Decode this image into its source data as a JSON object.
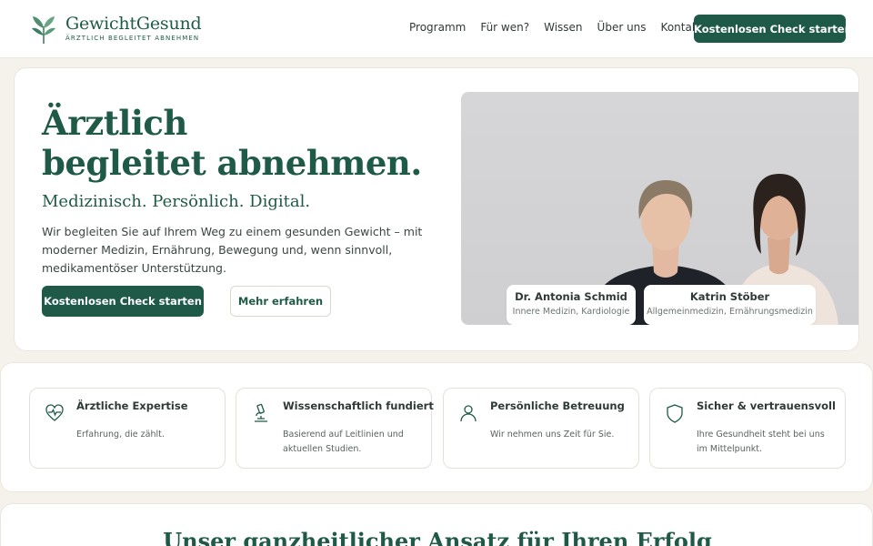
{
  "brand": {
    "name": "GewichtGesund",
    "tagline": "ÄRZTLICH BEGLEITET ABNEHMEN",
    "logo_icon": "leaf-sprout-icon"
  },
  "nav": {
    "items": [
      "Programm",
      "Für wen?",
      "Wissen",
      "Über uns",
      "Kontakt"
    ],
    "cta_label": "Kostenlosen Check starten"
  },
  "hero": {
    "title_line1": "Ärztlich",
    "title_line2": "begleitet abnehmen.",
    "subtitle": "Medizinisch. Persönlich. Digital.",
    "text": "Wir begleiten Sie auf Ihrem Weg zu einem gesunden Gewicht – mit moderner Medizin, Ernährung, Bewegung und, wenn sinnvoll, medikamentöser Unterstützung.",
    "primary_label": "Kostenlosen Check starten",
    "secondary_label": "Mehr erfahren",
    "doctors": [
      {
        "name": "Dr. Antonia Schmid",
        "role": "Innere Medizin, Kardiologie"
      },
      {
        "name": "Katrin Stöber",
        "role": "Allgemeinmedizin, Ernährungsmedizin"
      }
    ]
  },
  "features": [
    {
      "icon": "heart-pulse-icon",
      "title": "Ärztliche Expertise",
      "text": "Erfahrung, die zählt."
    },
    {
      "icon": "microscope-icon",
      "title": "Wissenschaftlich fundiert",
      "text": "Basierend auf Leitlinien und aktuellen Studien."
    },
    {
      "icon": "person-icon",
      "title": "Persönliche Betreuung",
      "text": "Wir nehmen uns Zeit für Sie."
    },
    {
      "icon": "shield-icon",
      "title": "Sicher & vertrauensvoll",
      "text": "Ihre Gesundheit steht bei uns im Mittelpunkt."
    }
  ],
  "approach": {
    "title": "Unser ganzheitlicher Ansatz für Ihren Erfolg"
  },
  "colors": {
    "brand_green": "#1f5a48",
    "background": "#f5f2ec",
    "card": "#ffffff"
  }
}
